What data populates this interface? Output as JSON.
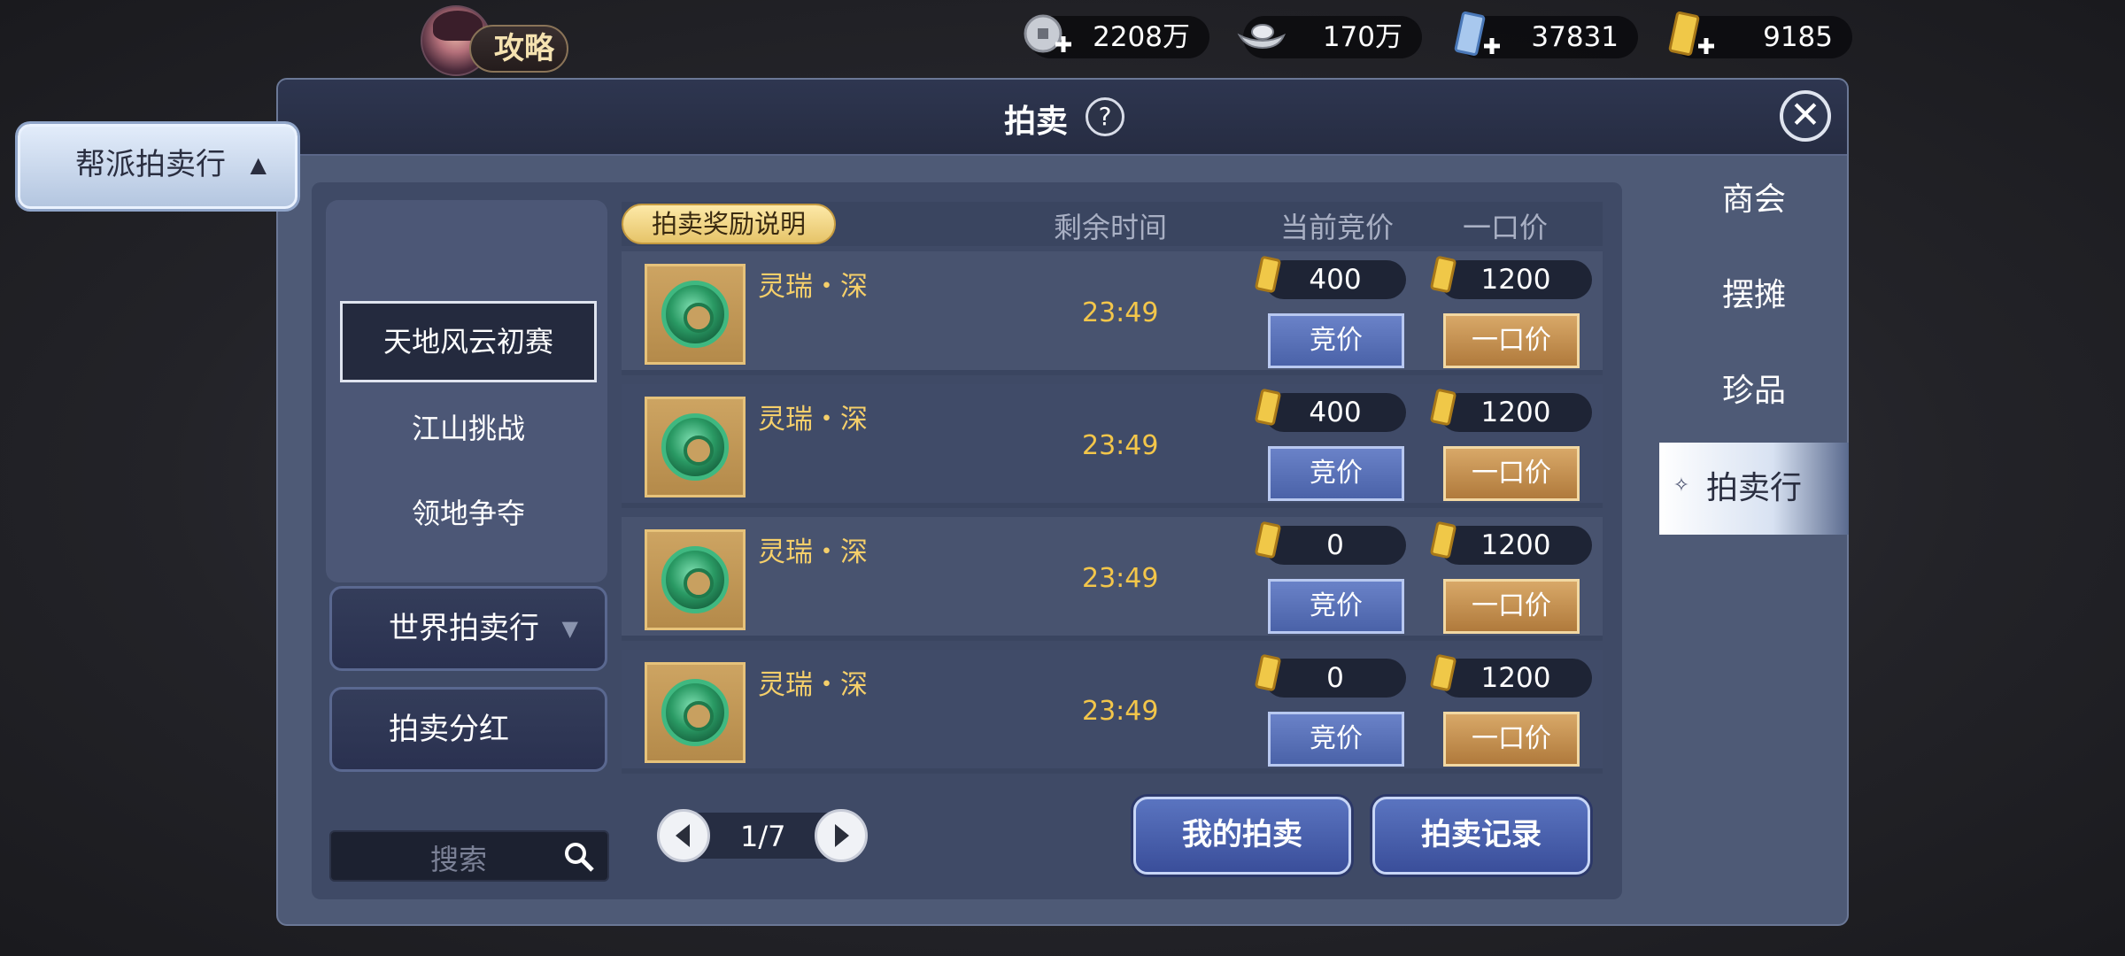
{
  "guide": {
    "label": "攻略"
  },
  "currencies": [
    {
      "name": "coin-icon",
      "value": "2208万"
    },
    {
      "name": "silver-ingot-icon",
      "value": "170万"
    },
    {
      "name": "blue-ticket-icon",
      "value": "37831"
    },
    {
      "name": "gold-ticket-icon",
      "value": "9185"
    }
  ],
  "panel": {
    "title": "拍卖",
    "help": "?",
    "close": "✕"
  },
  "left_menu": {
    "guild_auction": "帮派拍卖行",
    "sub_items": [
      "天地风云初赛",
      "江山挑战",
      "领地争夺"
    ],
    "world_auction": "世界拍卖行",
    "dividend": "拍卖分红",
    "search_placeholder": "搜索"
  },
  "list": {
    "reward_info": "拍卖奖励说明",
    "headers": {
      "time_left": "剩余时间",
      "current_bid": "当前竞价",
      "buyout": "一口价"
    },
    "rows": [
      {
        "name": "灵瑞・深",
        "time": "23:49",
        "bid": "400",
        "buyout": "1200",
        "bid_label": "竞价",
        "buy_label": "一口价"
      },
      {
        "name": "灵瑞・深",
        "time": "23:49",
        "bid": "400",
        "buyout": "1200",
        "bid_label": "竞价",
        "buy_label": "一口价"
      },
      {
        "name": "灵瑞・深",
        "time": "23:49",
        "bid": "0",
        "buyout": "1200",
        "bid_label": "竞价",
        "buy_label": "一口价"
      },
      {
        "name": "灵瑞・深",
        "time": "23:49",
        "bid": "0",
        "buyout": "1200",
        "bid_label": "竞价",
        "buy_label": "一口价"
      }
    ]
  },
  "pager": {
    "text": "1/7"
  },
  "actions": {
    "my_auctions": "我的拍卖",
    "auction_records": "拍卖记录"
  },
  "tabs": [
    "商会",
    "摆摊",
    "珍品",
    "拍卖行"
  ],
  "active_tab": "拍卖行",
  "colors": {
    "accent_gold": "#f5cf6a",
    "panel": "#4e5a76",
    "bid_button": "#4a62a8",
    "buy_button": "#b07a3c"
  }
}
